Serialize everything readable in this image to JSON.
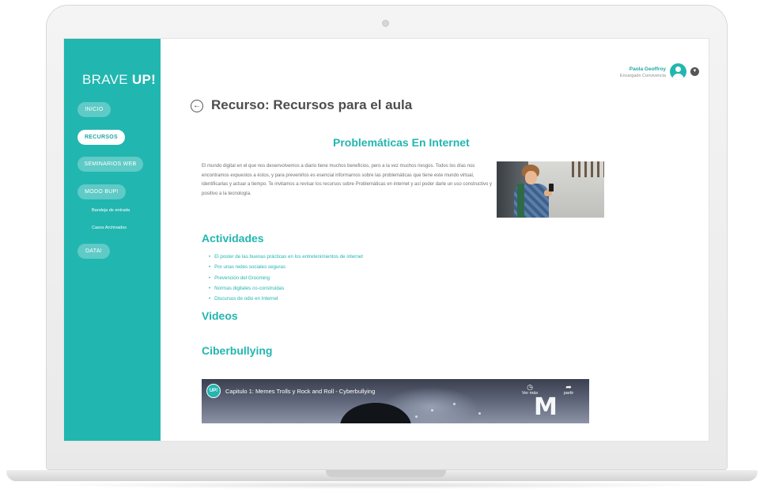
{
  "sidebar": {
    "logo_thin": "BRAVE ",
    "logo_bold": "UP!",
    "items": [
      {
        "label": "INICIO"
      },
      {
        "label": "RECURSOS"
      },
      {
        "label": "SEMINARIOS WEB"
      },
      {
        "label": "MODO BUP!"
      },
      {
        "label": "DATA!"
      }
    ],
    "sub_items": [
      {
        "label": "Bandeja de entrada"
      },
      {
        "label": "Casos Archivados"
      }
    ]
  },
  "header": {
    "user_name": "Paola Geoffroy",
    "user_role": "Encargado Convivencia",
    "caret_icon": "chevron-down-icon"
  },
  "page": {
    "title": "Recurso: Recursos para el aula",
    "back_icon": "←",
    "section_title": "Problemáticas En Internet",
    "intro": "El mundo digital en el que nos desenvolvemos a diario tiene muchos beneficios, pero a la vez muchos riesgos. Todos los días nos encontramos expuestos a éstos, y para prevenirlos es esencial informarnos sobre las problemáticas que tiene este mundo virtual, identificarlas y actuar a tiempo. Te invitamos a revisar los recursos sobre Problemáticas en internet y así poder darle un uso constructivo y positivo a la tecnología.",
    "activities_title": "Actividades",
    "activities": [
      "El poster de las buenas prácticas en los entretenimientos de internet",
      "Por unas redes sociales seguras",
      "Prevención del Grooming",
      "Normas digitales co-construidas",
      "Discursos de odio en Internet"
    ],
    "videos_title": "Videos",
    "cyberbullying_title": "Ciberbullying"
  },
  "video": {
    "channel_badge": "UP!",
    "title": "Capitulo 1: Memes Trolls y Rock and Roll - Cyberbullying",
    "watch_later": "Ver más",
    "share": "partir",
    "brand": "M"
  },
  "colors": {
    "accent": "#22b6b0",
    "title_text": "#4d4d4d",
    "body_text": "#6f6f6f"
  }
}
